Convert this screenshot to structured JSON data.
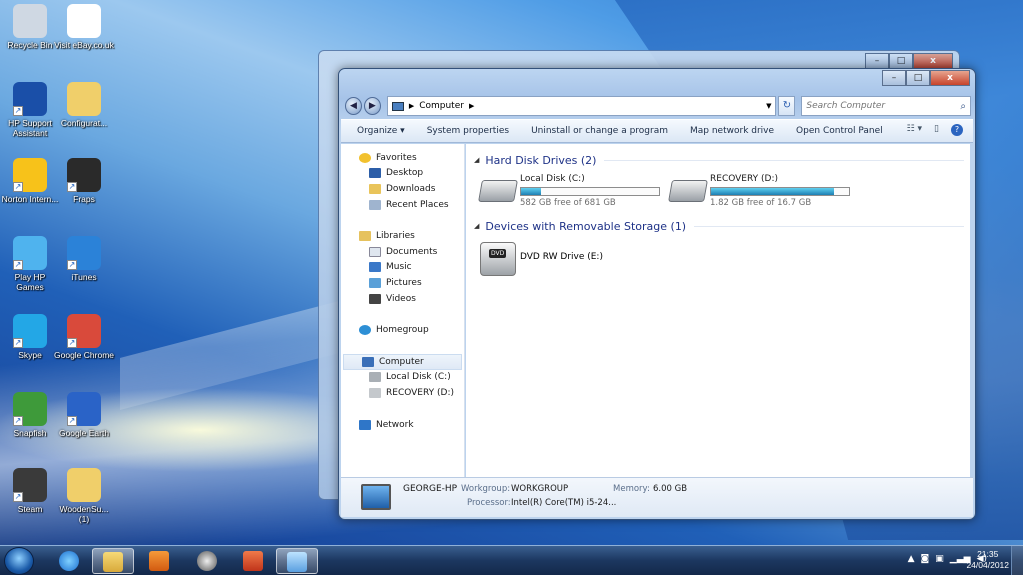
{
  "desktop": {
    "icons": [
      {
        "label": "Recycle Bin",
        "icon": "recycle-bin-icon",
        "color": "#cfd8e3"
      },
      {
        "label": "Visit eBay.co.uk",
        "icon": "ebay-icon",
        "color": "#ffffff"
      },
      {
        "label": "HP Support Assistant",
        "icon": "help-icon",
        "color": "#1a4fa8"
      },
      {
        "label": "Configurat...",
        "icon": "folder-icon",
        "color": "#f0cf6a"
      },
      {
        "label": "Norton Intern...",
        "icon": "norton-icon",
        "color": "#f7c21a"
      },
      {
        "label": "Fraps",
        "icon": "fraps-icon",
        "color": "#2a2a2a"
      },
      {
        "label": "Play HP Games",
        "icon": "hp-games-icon",
        "color": "#4fb3ee"
      },
      {
        "label": "iTunes",
        "icon": "itunes-icon",
        "color": "#2b82d8"
      },
      {
        "label": "Skype",
        "icon": "skype-icon",
        "color": "#23a7e6"
      },
      {
        "label": "Google Chrome",
        "icon": "chrome-icon",
        "color": "#d94a3b"
      },
      {
        "label": "Snapfish",
        "icon": "snapfish-icon",
        "color": "#3e9a3a"
      },
      {
        "label": "Google Earth",
        "icon": "google-earth-icon",
        "color": "#2a63c7"
      },
      {
        "label": "Steam",
        "icon": "steam-icon",
        "color": "#3a3a3a"
      },
      {
        "label": "WoodenSu... (1)",
        "icon": "folder-icon",
        "color": "#f0cf6a"
      }
    ]
  },
  "window": {
    "controls": {
      "minimize": "–",
      "maximize": "□",
      "close": "x"
    },
    "address": {
      "root": "Computer"
    },
    "search": {
      "placeholder": "Search Computer"
    },
    "toolbar": {
      "organize": "Organize ▾",
      "system_properties": "System properties",
      "uninstall": "Uninstall or change a program",
      "map_drive": "Map network drive",
      "control_panel": "Open Control Panel"
    },
    "nav": {
      "favorites": "Favorites",
      "desktop": "Desktop",
      "downloads": "Downloads",
      "recent": "Recent Places",
      "libraries": "Libraries",
      "documents": "Documents",
      "music": "Music",
      "pictures": "Pictures",
      "videos": "Videos",
      "homegroup": "Homegroup",
      "computer": "Computer",
      "local_disk": "Local Disk (C:)",
      "recovery": "RECOVERY (D:)",
      "network": "Network"
    },
    "content": {
      "hdd_group": "Hard Disk Drives (2)",
      "removable_group": "Devices with Removable Storage (1)",
      "drives": [
        {
          "name": "Local Disk (C:)",
          "free_text": "582 GB free of 681 GB",
          "used_fraction": 0.145
        },
        {
          "name": "RECOVERY (D:)",
          "free_text": "1.82 GB free of 16.7 GB",
          "used_fraction": 0.89
        }
      ],
      "dvd": {
        "name": "DVD RW Drive (E:)",
        "badge": "DVD"
      }
    },
    "details": {
      "computer_name": "GEORGE-HP",
      "workgroup_label": "Workgroup:",
      "workgroup": "WORKGROUP",
      "memory_label": "Memory:",
      "memory": "6.00 GB",
      "processor_label": "Processor:",
      "processor": "Intel(R) Core(TM) i5-24..."
    }
  },
  "taskbar": {
    "clock_time": "21:35",
    "clock_date": "24/04/2012",
    "tray": [
      "▲",
      "◙",
      "▣",
      "▁▃▅",
      "◀)"
    ]
  }
}
